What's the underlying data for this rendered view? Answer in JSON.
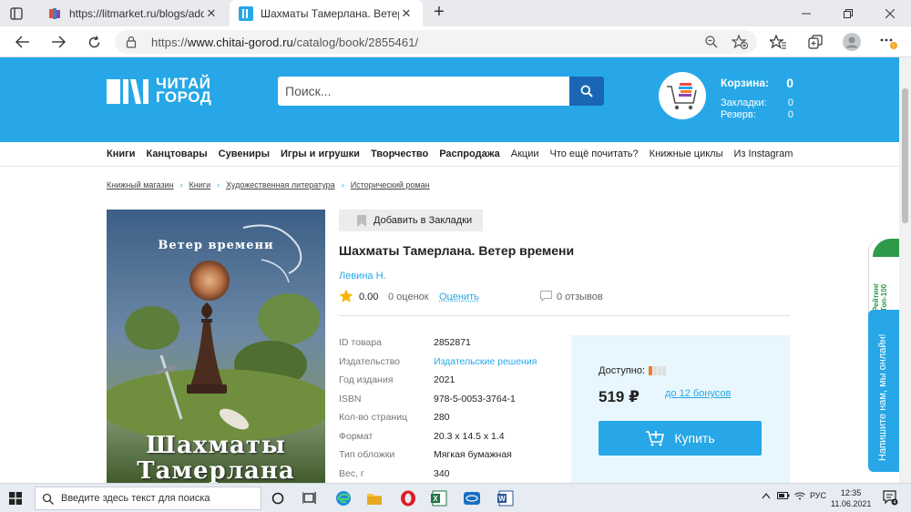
{
  "browser": {
    "tabs": [
      {
        "title": "https://litmarket.ru/blogs/add",
        "active": false
      },
      {
        "title": "Шахматы Тамерлана. Ветер време",
        "active": true
      }
    ],
    "new_tab": "+",
    "address": {
      "prefix": "https://",
      "host": "www.chitai-gorod.ru",
      "path": "/catalog/book/2855461/"
    },
    "icons": [
      "tab-actions-icon",
      "back-icon",
      "forward-icon",
      "refresh-icon",
      "lock-icon",
      "zoom-icon",
      "add-favorite-icon",
      "favorites-icon",
      "collections-icon",
      "profile-icon",
      "more-icon"
    ]
  },
  "header": {
    "logo_line1": "ЧИТАЙ",
    "logo_line2": "ГОРОД",
    "search_placeholder": "Поиск...",
    "cart": {
      "label": "Корзина:",
      "value": "0"
    },
    "bookmarks": {
      "label": "Закладки:",
      "value": "0"
    },
    "reserve": {
      "label": "Резерв:",
      "value": "0"
    }
  },
  "nav": [
    {
      "label": "Книги",
      "bold": true
    },
    {
      "label": "Канцтовары",
      "bold": true
    },
    {
      "label": "Сувениры",
      "bold": true
    },
    {
      "label": "Игры и игрушки",
      "bold": true
    },
    {
      "label": "Творчество",
      "bold": true
    },
    {
      "label": "Распродажа",
      "bold": true
    },
    {
      "label": "Акции",
      "bold": false
    },
    {
      "label": "Что ещё почитать?",
      "bold": false
    },
    {
      "label": "Книжные циклы",
      "bold": false
    },
    {
      "label": "Из Instagram",
      "bold": false
    }
  ],
  "breadcrumb": [
    "Книжный магазин",
    "Книги",
    "Художественная литература",
    "Исторический роман"
  ],
  "breadcrumb_sep": "›",
  "product": {
    "cover_title_top": "Ветер времени",
    "cover_title_bottom_1": "Шахматы",
    "cover_title_bottom_2": "Тамерлана",
    "bookmark_button": "Добавить в Закладки",
    "title": "Шахматы Тамерлана. Ветер времени",
    "author": "Левина Н.",
    "rating_value": "0.00",
    "rating_count": "0 оценок",
    "rate_link": "Оценить",
    "reviews": "0 отзывов",
    "props": [
      {
        "k": "ID товара",
        "v": "2852871",
        "link": false
      },
      {
        "k": "Издательство",
        "v": "Издательские решения",
        "link": true
      },
      {
        "k": "Год издания",
        "v": "2021",
        "link": false
      },
      {
        "k": "ISBN",
        "v": "978-5-0053-3764-1",
        "link": false
      },
      {
        "k": "Кол-во страниц",
        "v": "280",
        "link": false
      },
      {
        "k": "Формат",
        "v": "20.3 x 14.5 x 1.4",
        "link": false
      },
      {
        "k": "Тип обложки",
        "v": "Мягкая бумажная",
        "link": false
      },
      {
        "k": "Вес, г",
        "v": "340",
        "link": false
      }
    ]
  },
  "buy": {
    "availability_label": "Доступно:",
    "availability_level": 0.25,
    "price": "519 ₽",
    "bonus": "до 12 бонусов",
    "button": "Купить"
  },
  "side": {
    "rating_line1": "Рейтинг",
    "rating_line2": "Топ-100",
    "chat": "Напишите нам, мы онлайн!"
  },
  "taskbar": {
    "search_placeholder": "Введите здесь текст для поиска",
    "lang": "РУС",
    "time": "12:35",
    "date": "11.06.2021",
    "notifications": "4"
  },
  "colors": {
    "brand_blue": "#27a7e7",
    "dark_blue": "#1966b4",
    "buy_box": "#e8f6fd",
    "accent_orange": "#f07d2a"
  }
}
